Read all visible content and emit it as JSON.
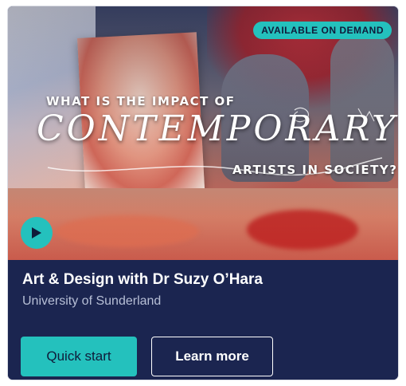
{
  "badge": {
    "label": "AVAILABLE ON DEMAND",
    "color": "#24c1bd"
  },
  "hero": {
    "title_line1": "WHAT IS THE IMPACT OF",
    "title_main": "CONTEMPORARY",
    "title_line3": "ARTISTS IN SOCIETY?"
  },
  "play": {
    "icon": "play-icon"
  },
  "course": {
    "title": "Art & Design with Dr Suzy O’Hara",
    "institution": "University of Sunderland"
  },
  "actions": {
    "quick_start": "Quick start",
    "learn_more": "Learn more"
  },
  "colors": {
    "card_bg": "#1b2550",
    "accent": "#24c1bd"
  }
}
